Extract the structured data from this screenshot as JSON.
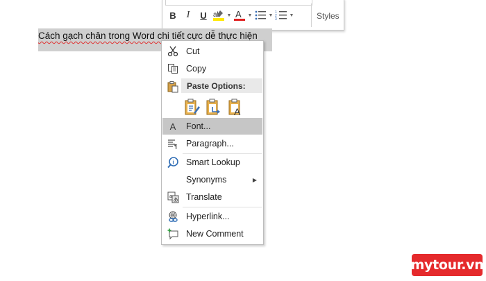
{
  "document": {
    "selected_text": "Cách gạch chân trong Word chi tiết cực dễ thực hiện"
  },
  "mini_toolbar": {
    "bold": "B",
    "italic": "I",
    "underline": "U",
    "font_color": "A",
    "styles_label": "Styles",
    "highlight_color": "#ffe800",
    "font_color_bar": "#e02020"
  },
  "context_menu": {
    "items": [
      {
        "label": "Cut",
        "icon": "scissors-icon"
      },
      {
        "label": "Copy",
        "icon": "copy-icon"
      },
      {
        "label": "Font...",
        "icon": "font-icon",
        "highlighted": true
      },
      {
        "label": "Paragraph...",
        "icon": "paragraph-icon"
      },
      {
        "label": "Smart Lookup",
        "icon": "smart-lookup-icon"
      },
      {
        "label": "Synonyms",
        "icon": "none",
        "has_submenu": true
      },
      {
        "label": "Translate",
        "icon": "translate-icon"
      },
      {
        "label": "Hyperlink...",
        "icon": "hyperlink-icon"
      },
      {
        "label": "New Comment",
        "icon": "new-comment-icon"
      }
    ],
    "paste_options_header": "Paste Options:",
    "paste_options": [
      "keep-source-formatting",
      "merge-formatting",
      "keep-text-only"
    ]
  },
  "watermark": {
    "text": "mytour.vn",
    "color": "#e52a2c"
  }
}
